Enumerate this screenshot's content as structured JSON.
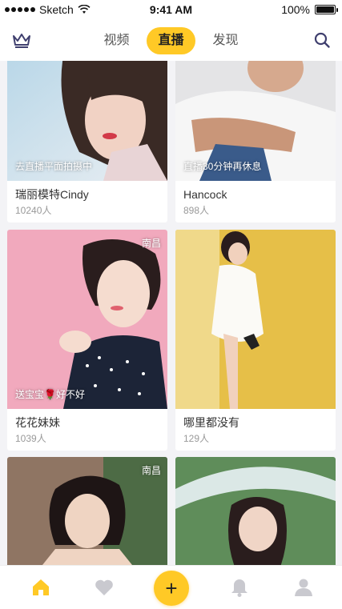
{
  "status_bar": {
    "carrier": "Sketch",
    "time": "9:41 AM",
    "battery": "100%",
    "battery_level": 1.0
  },
  "nav": {
    "tabs": [
      {
        "label": "视频",
        "active": false
      },
      {
        "label": "直播",
        "active": true
      },
      {
        "label": "发现",
        "active": false
      }
    ],
    "left_icon": "crown-icon",
    "right_icon": "search-icon"
  },
  "cards": [
    {
      "name": "瑞丽模特Cindy",
      "count": "10240人",
      "overlay": "去直播平面拍摄中",
      "city": ""
    },
    {
      "name": "Hancock",
      "count": "898人",
      "overlay": "直播30分钟再休息",
      "city": ""
    },
    {
      "name": "花花妹妹",
      "count": "1039人",
      "overlay": "送宝宝🌹好不好",
      "city": "南昌"
    },
    {
      "name": "哪里都没有",
      "count": "129人",
      "overlay": "",
      "city": ""
    },
    {
      "name": "",
      "count": "",
      "overlay": "",
      "city": "南昌"
    },
    {
      "name": "",
      "count": "",
      "overlay": "",
      "city": ""
    }
  ],
  "bottom_bar": {
    "items": [
      "home-icon",
      "heart-icon",
      "plus-icon",
      "bell-icon",
      "profile-icon"
    ],
    "plus_label": "+",
    "active": "home-icon"
  },
  "colors": {
    "accent": "#ffc926",
    "icon_inactive": "#c9c9cf",
    "nav_icon": "#3f3f6e"
  }
}
